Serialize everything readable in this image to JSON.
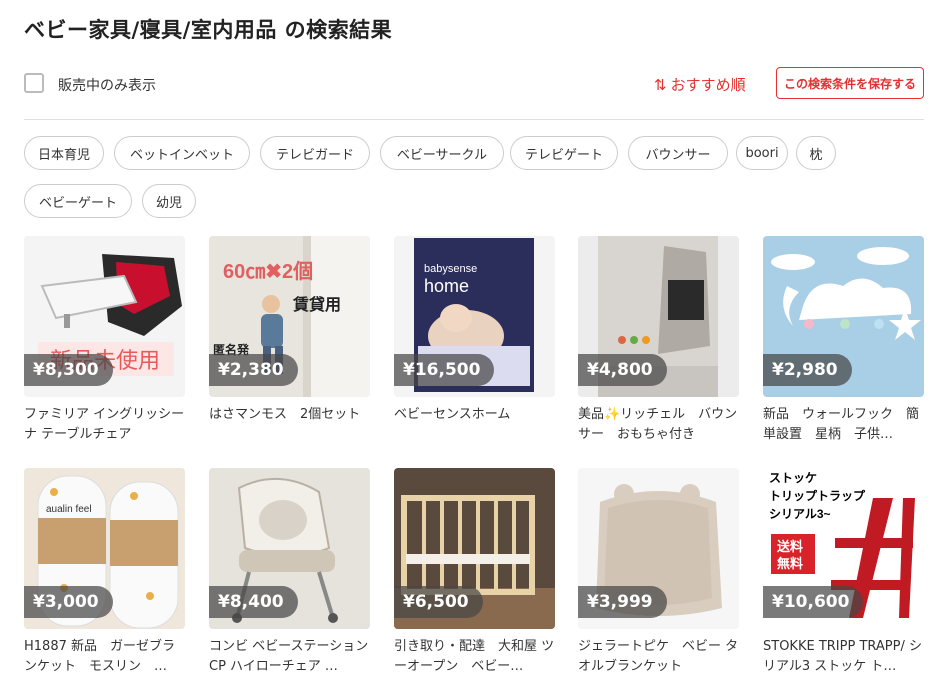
{
  "page": {
    "title": "ベビー家具/寝具/室内用品 の検索結果"
  },
  "filters": {
    "on_sale_label": "販売中のみ表示",
    "sort_label": "おすすめ順",
    "save_label": "この検索条件を保存する",
    "accent_color": "#e5302f"
  },
  "tags": [
    "日本育児",
    "ベットインベット",
    "テレビガード",
    "ベビーサークル",
    "テレビゲート",
    "バウンサー",
    "boori",
    "枕",
    "ベビーゲート",
    "幼児"
  ],
  "products": [
    {
      "price": "¥8,300",
      "title": "ファミリア イングリッシーナ テーブルチェア",
      "overlay": "新品未使用"
    },
    {
      "price": "¥2,380",
      "title": "はさマンモス　2個セット",
      "overlay_size": "60㎝✖2個",
      "overlay_rent": "賃貸用",
      "overlay_ship": "匿名発"
    },
    {
      "price": "¥16,500",
      "title": "ベビーセンスホーム",
      "overlay_brand": "babysense",
      "overlay_brand2": "home"
    },
    {
      "price": "¥4,800",
      "title": "美品✨リッチェル　バウンサー　おもちゃ付き"
    },
    {
      "price": "¥2,980",
      "title": "新品　ウォールフック　簡単設置　星柄　子供…"
    },
    {
      "price": "¥3,000",
      "title": "H1887 新品　ガーゼブランケット　モスリン　…",
      "overlay_brand": "aualin feel"
    },
    {
      "price": "¥8,400",
      "title": "コンビ ベビーステーションCP ハイローチェア …"
    },
    {
      "price": "¥6,500",
      "title": "引き取り・配達　大和屋 ツーオープン　ベビー…"
    },
    {
      "price": "¥3,999",
      "title": "ジェラートピケ　ベビー タオルブランケット"
    },
    {
      "price": "¥10,600",
      "title": "STOKKE TRIPP TRAPP/ シリアル3 ストッケ ト…",
      "overlay_line1": "ストッケ",
      "overlay_line2": "トリップトラップ",
      "overlay_line3": "シリアル3~",
      "overlay_badge1": "送料",
      "overlay_badge2": "無料"
    }
  ]
}
